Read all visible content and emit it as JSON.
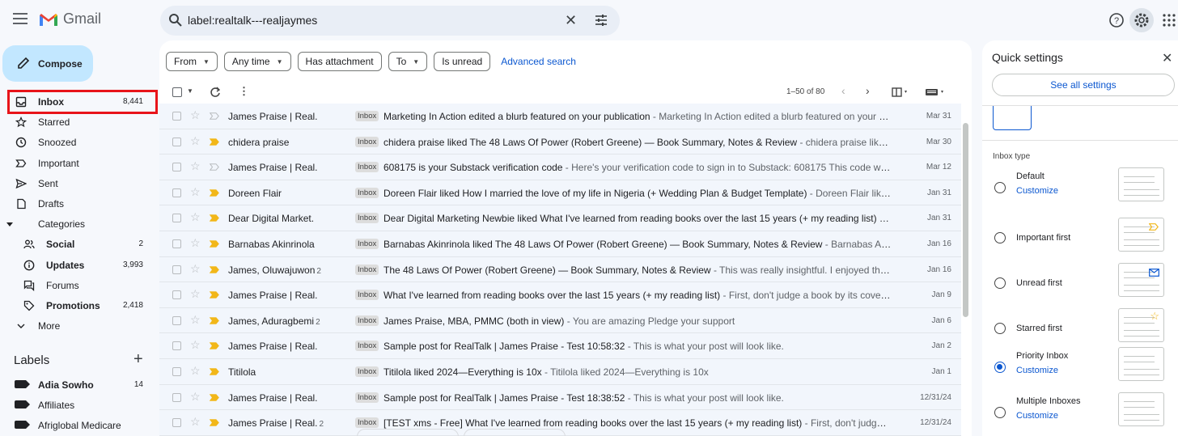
{
  "app": {
    "name": "Gmail"
  },
  "search": {
    "query": "label:realtalk---realjaymes"
  },
  "compose": {
    "label": "Compose"
  },
  "nav": [
    {
      "label": "Inbox",
      "count": "8,441",
      "bold": true
    },
    {
      "label": "Starred",
      "count": ""
    },
    {
      "label": "Snoozed",
      "count": ""
    },
    {
      "label": "Important",
      "count": ""
    },
    {
      "label": "Sent",
      "count": ""
    },
    {
      "label": "Drafts",
      "count": ""
    },
    {
      "label": "Categories",
      "count": ""
    },
    {
      "label": "Social",
      "count": "2",
      "bold": true,
      "sub": true
    },
    {
      "label": "Updates",
      "count": "3,993",
      "bold": true,
      "sub": true
    },
    {
      "label": "Forums",
      "count": "",
      "sub": true
    },
    {
      "label": "Promotions",
      "count": "2,418",
      "bold": true,
      "sub": true
    },
    {
      "label": "More",
      "count": ""
    }
  ],
  "labels": {
    "heading": "Labels",
    "items": [
      {
        "label": "Adia Sowho",
        "count": "14",
        "bold": true
      },
      {
        "label": "Affiliates",
        "count": ""
      },
      {
        "label": "Afriglobal Medicare",
        "count": ""
      }
    ]
  },
  "filters": {
    "chips": [
      "From",
      "Any time",
      "Has attachment",
      "To",
      "Is unread"
    ],
    "advanced": "Advanced search"
  },
  "pager": {
    "range": "1–50 of 80"
  },
  "emails": [
    {
      "sender": "James Praise | Real.",
      "count": "",
      "badge": "Inbox",
      "subject": "Marketing In Action edited a blurb featured on your publication",
      "preview": " - Marketing In Action edited a blurb featured on your publica...",
      "date": "Mar 31",
      "important": false
    },
    {
      "sender": "chidera praise",
      "count": "",
      "badge": "Inbox",
      "subject": "chidera praise liked The 48 Laws Of Power (Robert Greene) — Book Summary, Notes & Review",
      "preview": " - chidera praise liked The 48 ...",
      "date": "Mar 30",
      "important": true
    },
    {
      "sender": "James Praise | Real.",
      "count": "",
      "badge": "Inbox",
      "subject": "608175 is your Substack verification code",
      "preview": " - Here's your verification code to sign in to Substack: 608175 This code will only b...",
      "date": "Mar 12",
      "important": false
    },
    {
      "sender": "Doreen Flair",
      "count": "",
      "badge": "Inbox",
      "subject": "Doreen Flair liked How I married the love of my life in Nigeria (+ Wedding Plan & Budget Template)",
      "preview": " - Doreen Flair liked How I ...",
      "date": "Jan 31",
      "important": true
    },
    {
      "sender": "Dear Digital Market.",
      "count": "",
      "badge": "Inbox",
      "subject": "Dear Digital Marketing Newbie liked What I've learned from reading books over the last 15 years (+ my reading list)",
      "preview": " - Dear Di...",
      "date": "Jan 31",
      "important": true
    },
    {
      "sender": "Barnabas Akinrinola",
      "count": "",
      "badge": "Inbox",
      "subject": "Barnabas Akinrinola liked The 48 Laws Of Power (Robert Greene) — Book Summary, Notes & Review",
      "preview": " - Barnabas Akinrinola li...",
      "date": "Jan 16",
      "important": true
    },
    {
      "sender": "James, Oluwajuwon",
      "count": "2",
      "badge": "Inbox",
      "subject": "The 48 Laws Of Power (Robert Greene) — Book Summary, Notes & Review",
      "preview": " - This was really insightful. I enjoyed the summary...",
      "date": "Jan 16",
      "important": true
    },
    {
      "sender": "James Praise | Real.",
      "count": "",
      "badge": "Inbox",
      "subject": "What I've learned from reading books over the last 15 years (+ my reading list)",
      "preview": " - First, don't judge a book by its cover—unles...",
      "date": "Jan 9",
      "important": true
    },
    {
      "sender": "James, Aduragbemi",
      "count": "2",
      "badge": "Inbox",
      "subject": "James Praise, MBA, PMMC (both in view)",
      "preview": " - You are amazing Pledge your support",
      "date": "Jan 6",
      "important": true
    },
    {
      "sender": "James Praise | Real.",
      "count": "",
      "badge": "Inbox",
      "subject": "Sample post for RealTalk | James Praise - Test 10:58:32",
      "preview": " - This is what your post will look like.",
      "date": "Jan 2",
      "important": true
    },
    {
      "sender": "Titilola",
      "count": "",
      "badge": "Inbox",
      "subject": "Titilola liked 2024—Everything is 10x",
      "preview": " - Titilola liked 2024—Everything is 10x",
      "date": "Jan 1",
      "important": true
    },
    {
      "sender": "James Praise | Real.",
      "count": "",
      "badge": "Inbox",
      "subject": "Sample post for RealTalk | James Praise - Test 18:38:52",
      "preview": " - This is what your post will look like.",
      "date": "12/31/24",
      "important": true
    },
    {
      "sender": "James Praise | Real.",
      "count": "2",
      "badge": "Inbox",
      "subject": "[TEST xms - Free] What I've learned from reading books over the last 15 years (+ my reading list)",
      "preview": " - First, don't judge a book b...",
      "date": "12/31/24",
      "important": true
    }
  ],
  "quick_settings": {
    "title": "Quick settings",
    "see_all": "See all settings",
    "inbox_type_heading": "Inbox type",
    "options": [
      {
        "name": "Default",
        "customize": "Customize",
        "selected": false,
        "icon": ""
      },
      {
        "name": "Important first",
        "customize": "",
        "selected": false,
        "icon": "important-marker-icon"
      },
      {
        "name": "Unread first",
        "customize": "",
        "selected": false,
        "icon": "mail-icon"
      },
      {
        "name": "Starred first",
        "customize": "",
        "selected": false,
        "icon": "star-icon"
      },
      {
        "name": "Priority Inbox",
        "customize": "Customize",
        "selected": true,
        "icon": ""
      },
      {
        "name": "Multiple Inboxes",
        "customize": "Customize",
        "selected": false,
        "icon": ""
      }
    ]
  },
  "colors": {
    "accent": "#0b57d0",
    "compose_bg": "#c2e7ff",
    "important": "#f2b719",
    "highlight_box": "#e8141a"
  }
}
